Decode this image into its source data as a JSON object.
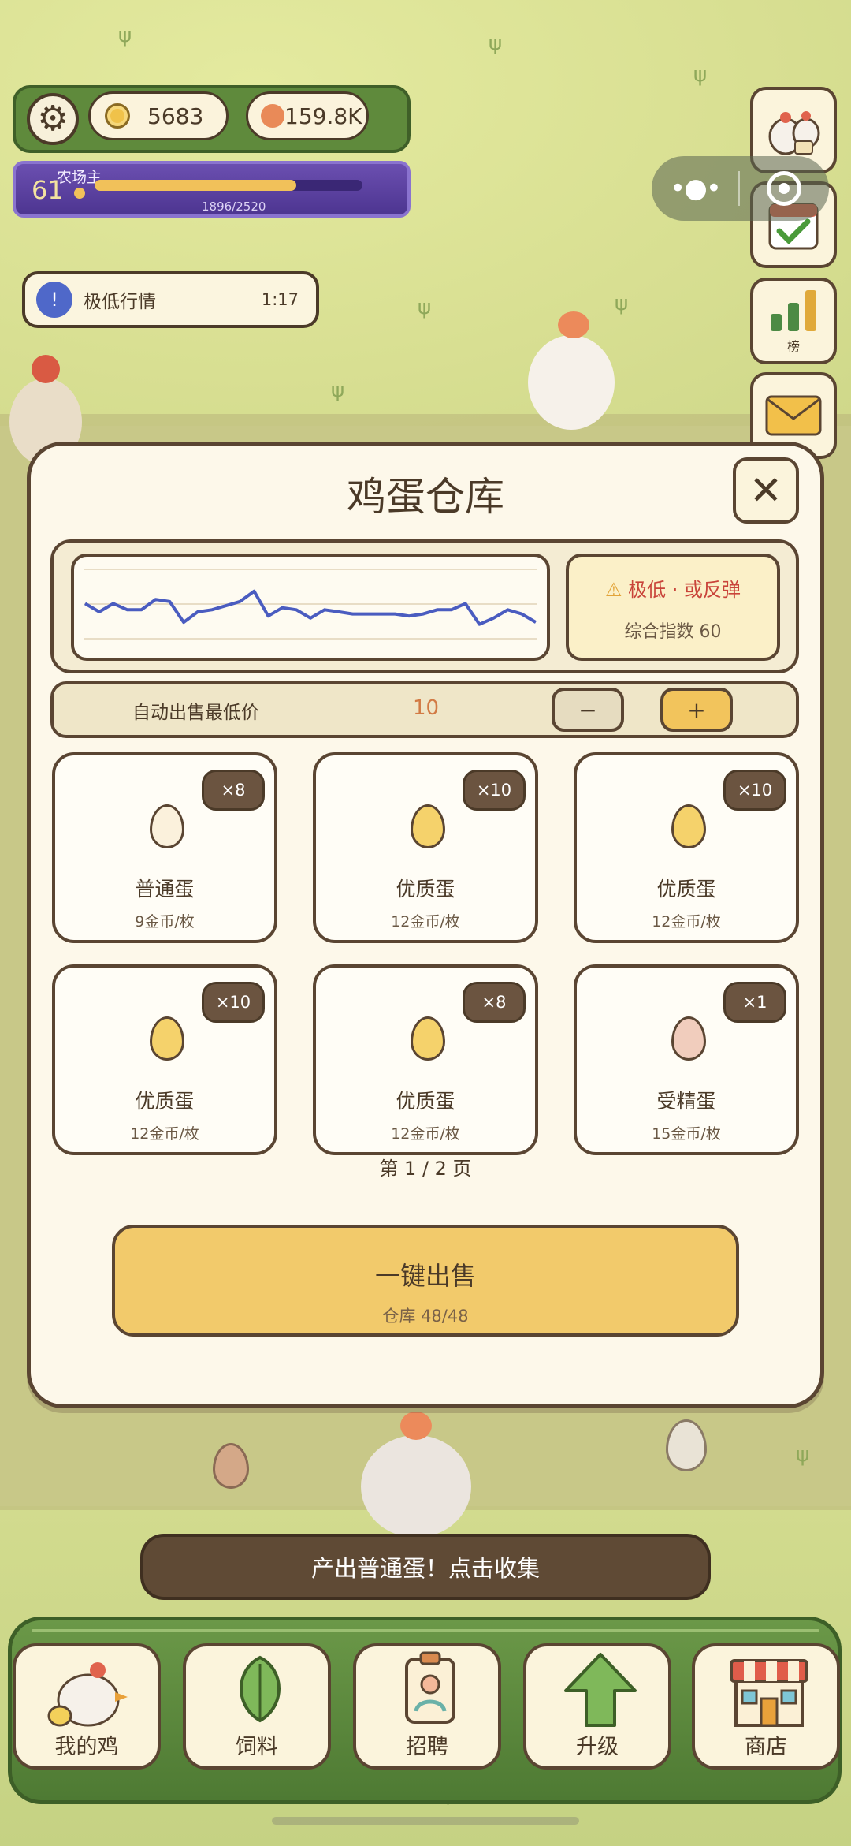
{
  "hud": {
    "coins": "5683",
    "gems": "159.8K",
    "level": "61",
    "level_title": "农场主",
    "xp_text": "1896/2520",
    "xp_progress": 0.752,
    "market_event": {
      "icon_text": "!",
      "label": "极低行情",
      "time": "1:17"
    }
  },
  "side_buttons": {
    "rank_label": "榜"
  },
  "panel": {
    "title": "鸡蛋仓库",
    "close_label": "✕",
    "trend": {
      "values": [
        60,
        56,
        60,
        57,
        57,
        62,
        61,
        51,
        56,
        57,
        59,
        61,
        66,
        54,
        58,
        57,
        53,
        57,
        56,
        55,
        55,
        55,
        55,
        54,
        55,
        57,
        57,
        60,
        50,
        53,
        57,
        55,
        51
      ]
    },
    "signal": {
      "icon": "⚠",
      "warning": "极低 · 或反弹",
      "index_text": "综合指数 60"
    },
    "auto_sell": {
      "label": "自动出售最低价",
      "value": "10",
      "minus": "−",
      "plus": "+"
    },
    "eggs": [
      {
        "count": "×8",
        "name": "普通蛋",
        "price": "9金币/枚",
        "color": "#fbf1dc"
      },
      {
        "count": "×10",
        "name": "优质蛋",
        "price": "12金币/枚",
        "color": "#f5d26b"
      },
      {
        "count": "×10",
        "name": "优质蛋",
        "price": "12金币/枚",
        "color": "#f5d26b"
      },
      {
        "count": "×10",
        "name": "优质蛋",
        "price": "12金币/枚",
        "color": "#f5d26b"
      },
      {
        "count": "×8",
        "name": "优质蛋",
        "price": "12金币/枚",
        "color": "#f5d26b"
      },
      {
        "count": "×1",
        "name": "受精蛋",
        "price": "15金币/枚",
        "color": "#f1cdbd"
      }
    ],
    "page_indicator": "第 1 / 2 页",
    "sell_button": {
      "title": "一键出售",
      "subtitle": "仓库 48/48"
    }
  },
  "toast": "产出普通蛋！点击收集",
  "nav": {
    "my_chickens": "我的鸡",
    "feed": "饲料",
    "recruit": "招聘",
    "upgrade": "升级",
    "shop": "商店"
  }
}
